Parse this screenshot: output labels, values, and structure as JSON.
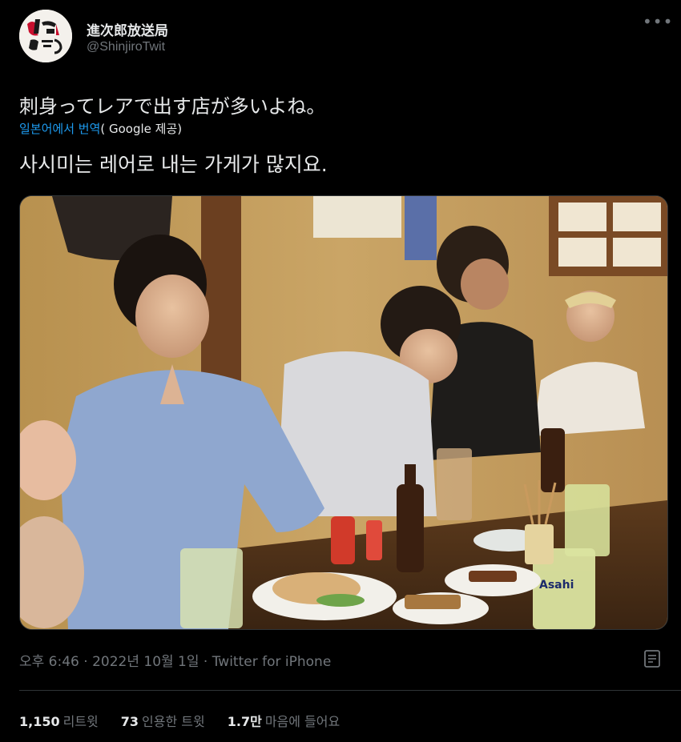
{
  "user": {
    "display_name": "進次郎放送局",
    "handle": "@ShinjiroTwit",
    "avatar_text": "進次郎放送局"
  },
  "tweet": {
    "text": "刺身ってレアで出す店が多いよね。",
    "translate_link": "일본어에서 번역",
    "translate_provider": "( Google 제공)",
    "translated_text": "사시미는 레어로 내는 가게가 많지요.",
    "timestamp": "오후 6:46 · 2022년 10월 1일",
    "separator": " · ",
    "source": "Twitter for iPhone"
  },
  "stats": {
    "retweets_count": "1,150",
    "retweets_label": "리트윗",
    "quotes_count": "73",
    "quotes_label": "인용한 트윗",
    "likes_count": "1.7만",
    "likes_label": "마음에 들어요"
  },
  "photo": {
    "beer_label": "Asahi"
  },
  "icons": {
    "more": "more-icon",
    "analytics": "analytics-icon"
  },
  "colors": {
    "background": "#000000",
    "text": "#e7e9ea",
    "secondary": "#71767b",
    "link": "#1d9bf0",
    "border": "#2f3336"
  }
}
